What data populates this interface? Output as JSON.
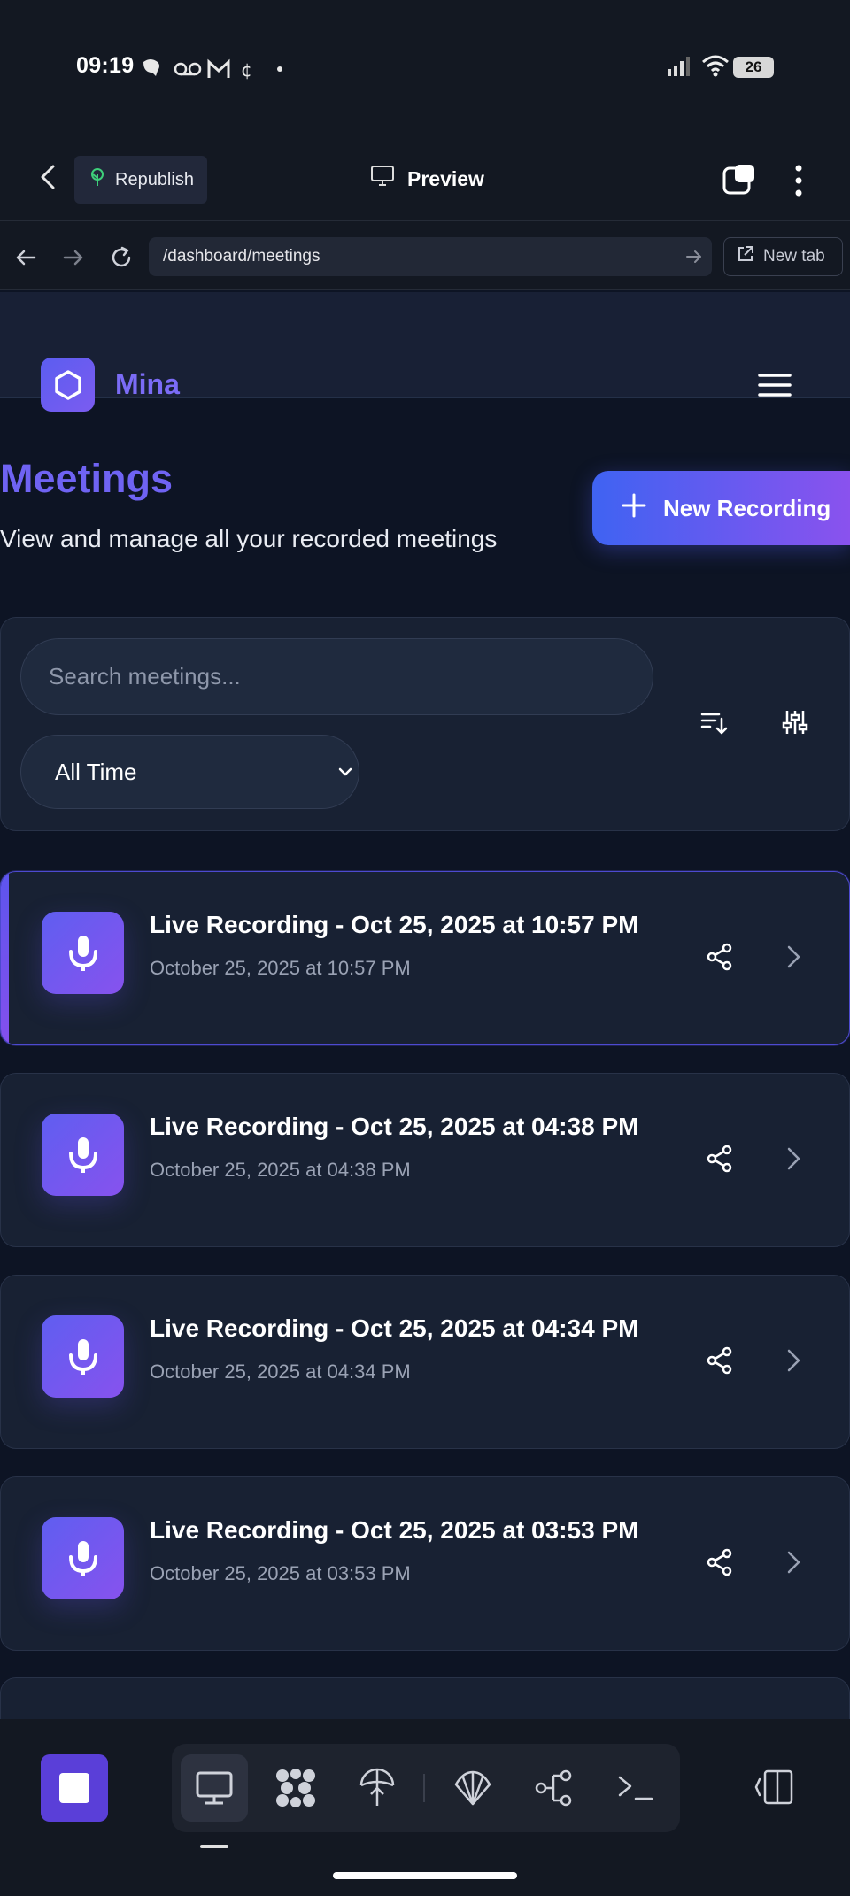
{
  "status_bar": {
    "time": "09:19",
    "battery": "26"
  },
  "topbar": {
    "republish_label": "Republish",
    "preview_label": "Preview"
  },
  "urlbar": {
    "url": "/dashboard/meetings",
    "new_tab_label": "New tab"
  },
  "app": {
    "name": "Mina"
  },
  "page": {
    "title": "Meetings",
    "subtitle": "View and manage all your recorded meetings",
    "new_recording_label": "New Recording"
  },
  "filters": {
    "search_placeholder": "Search meetings...",
    "range_selected": "All Time"
  },
  "meetings": [
    {
      "title": "Live Recording - Oct 25, 2025 at 10:57 PM",
      "date": "October 25, 2025 at 10:57 PM",
      "active": true
    },
    {
      "title": "Live Recording - Oct 25, 2025 at 04:38 PM",
      "date": "October 25, 2025 at 04:38 PM",
      "active": false
    },
    {
      "title": "Live Recording - Oct 25, 2025 at 04:34 PM",
      "date": "October 25, 2025 at 04:34 PM",
      "active": false
    },
    {
      "title": "Live Recording - Oct 25, 2025 at 03:53 PM",
      "date": "October 25, 2025 at 03:53 PM",
      "active": false
    }
  ],
  "dock": {
    "tools": [
      "desktop-icon",
      "grid-dots-icon",
      "satellite-icon",
      "shell-icon",
      "share-node-icon",
      "terminal-icon"
    ],
    "selected_tool": "desktop-icon"
  },
  "colors": {
    "accent": "#6f63f3",
    "background": "#0d1424",
    "card": "#182133"
  }
}
